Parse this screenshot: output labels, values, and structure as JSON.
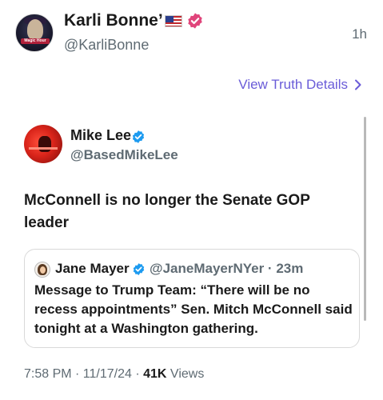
{
  "post": {
    "author_name": "Karli Bonne’",
    "author_handle": "@KarliBonne",
    "timestamp": "1h",
    "avatar_text": "Magic Hour",
    "view_details_label": "View Truth Details"
  },
  "embedded_tweet": {
    "author_name": "Mike Lee",
    "author_handle": "@BasedMikeLee",
    "text": "McConnell is no longer the Senate GOP leader",
    "quote": {
      "author_name": "Jane Mayer",
      "author_handle": "@JaneMayerNYer · 23m",
      "text": "Message to Trump Team: “There will be no recess appointments” Sen. Mitch McConnell said tonight at a Washington gathering."
    },
    "meta": {
      "time_date": "7:58 PM · 11/17/24 · ",
      "views_count": "41K",
      "views_label": " Views"
    }
  },
  "colors": {
    "accent_link": "#6a5cd8",
    "verified_pink": "#e0457b",
    "verified_blue": "#1d9bf0",
    "muted_text": "#5f6b73"
  },
  "icons": {
    "flag": "us-flag-icon",
    "verified": "verified-badge-icon",
    "chevron": "chevron-right-icon"
  }
}
